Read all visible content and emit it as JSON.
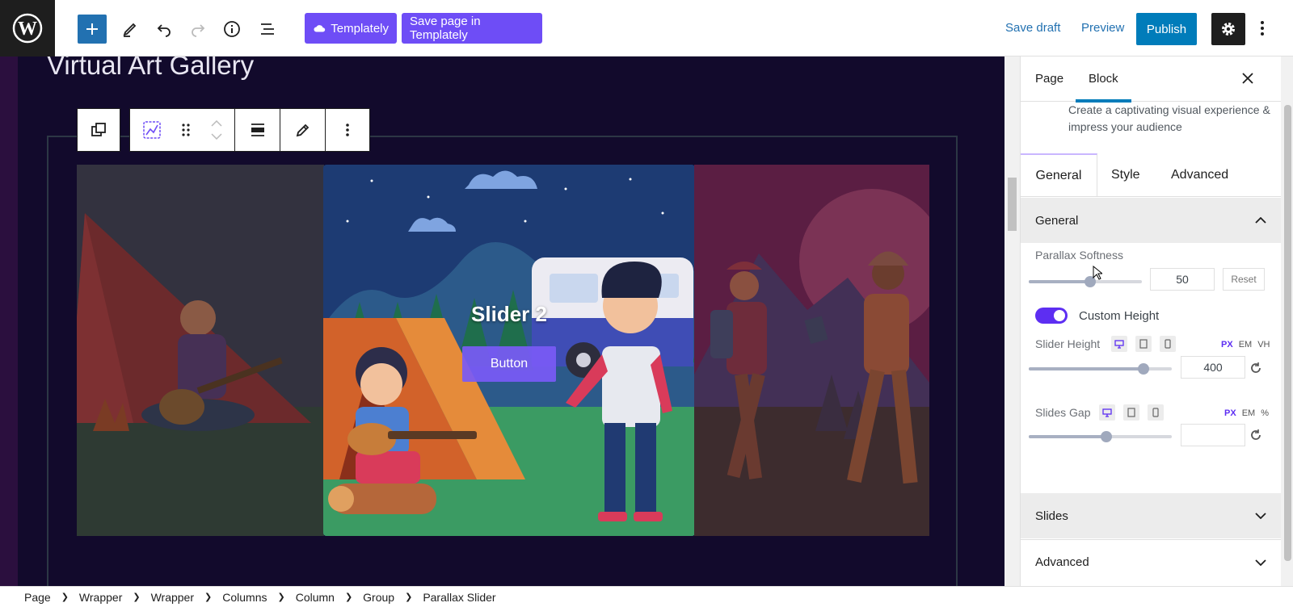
{
  "topbar": {
    "templately_label": "Templately",
    "save_templately_label": "Save page in Templately",
    "save_draft": "Save draft",
    "preview": "Preview",
    "publish": "Publish"
  },
  "canvas": {
    "page_title": "Virtual Art Gallery",
    "slides": [
      {
        "caption": "",
        "button": ""
      },
      {
        "caption": "Slider 2",
        "button": "Button"
      },
      {
        "caption": "",
        "button": ""
      }
    ]
  },
  "sidebar": {
    "tabs": [
      "Page",
      "Block"
    ],
    "active_tab": "Block",
    "description": "Create a captivating visual experience & impress your audience",
    "sub_tabs": [
      "General",
      "Style",
      "Advanced"
    ],
    "panels": {
      "general": "General",
      "slides": "Slides",
      "advanced": "Advanced"
    },
    "parallax_softness": {
      "label": "Parallax Softness",
      "value": "50",
      "reset": "Reset",
      "slider_level": 0.54
    },
    "custom_height": {
      "label": "Custom Height",
      "enabled": true
    },
    "slider_height": {
      "label": "Slider Height",
      "value": "400",
      "units": [
        "PX",
        "EM",
        "VH"
      ],
      "active_unit": "PX",
      "slider_level": 0.8
    },
    "slides_gap": {
      "label": "Slides Gap",
      "value": "",
      "units": [
        "PX",
        "EM",
        "%"
      ],
      "active_unit": "PX",
      "slider_level": 0.54
    }
  },
  "breadcrumb": [
    "Page",
    "Wrapper",
    "Wrapper",
    "Columns",
    "Column",
    "Group",
    "Parallax Slider"
  ],
  "colors": {
    "accent": "#007cba",
    "templately": "#6e4df6",
    "toggle": "#5d2ef2",
    "canvas": "#120a2c"
  }
}
